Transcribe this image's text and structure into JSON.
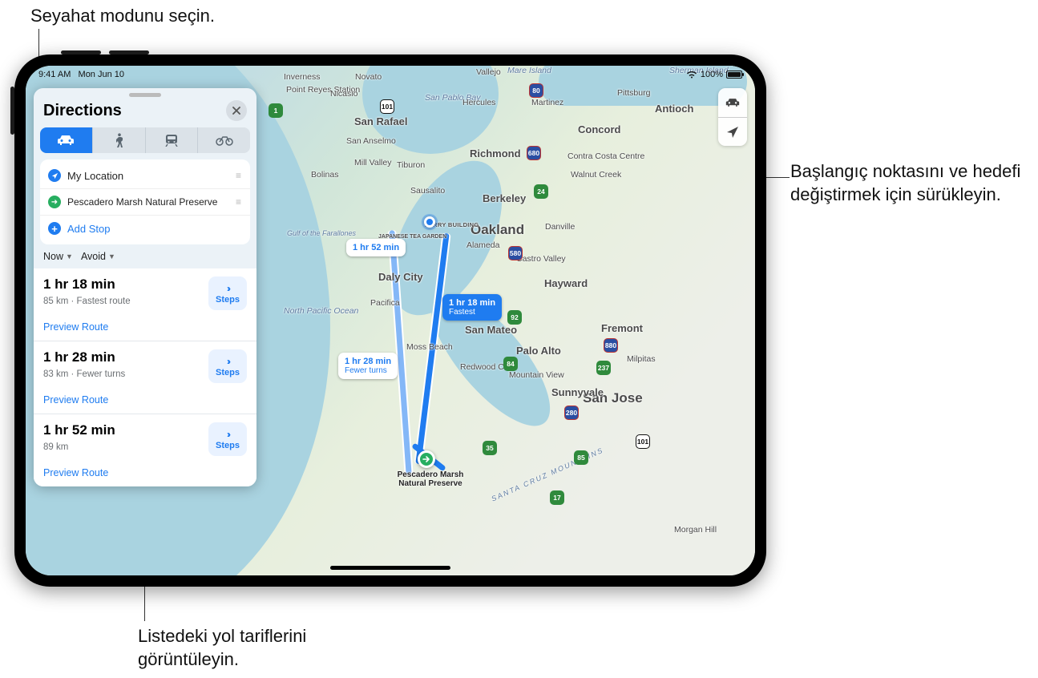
{
  "callouts": {
    "mode": "Seyahat modunu seçin.",
    "drag": "Başlangıç noktasını ve hedefi değiştirmek için sürükleyin.",
    "preview": "Listedeki yol tariflerini görüntüleyin."
  },
  "status": {
    "time": "9:41 AM",
    "date": "Mon Jun 10",
    "battery": "100%"
  },
  "panel": {
    "title": "Directions",
    "modes": [
      "drive",
      "walk",
      "transit",
      "cycle"
    ],
    "stops": {
      "origin": "My Location",
      "destination": "Pescadero Marsh Natural Preserve",
      "add": "Add Stop"
    },
    "options": {
      "now": "Now",
      "avoid": "Avoid"
    },
    "steps_label": "Steps",
    "preview_label": "Preview Route",
    "routes": [
      {
        "duration": "1 hr 18 min",
        "sub": "85 km · Fastest route"
      },
      {
        "duration": "1 hr 28 min",
        "sub": "83 km · Fewer turns"
      },
      {
        "duration": "1 hr 52 min",
        "sub": "89 km"
      }
    ]
  },
  "badges": {
    "main": {
      "line1": "1 hr 18 min",
      "line2": "Fastest"
    },
    "alt1": {
      "line1": "1 hr 28 min",
      "line2": "Fewer turns"
    },
    "alt2": {
      "line1": "1 hr 52 min"
    }
  },
  "map": {
    "destination_label": "Pescadero Marsh Natural Preserve",
    "region_labels": {
      "npacific": "North Pacific Ocean",
      "spablo": "San Pablo Bay",
      "mare": "Mare Island",
      "sherman": "Sherman Island",
      "gulf": "Gulf of the Farallones",
      "mtns": "SANTA CRUZ MOUNTAINS"
    },
    "cities": {
      "oakland": "Oakland",
      "sanjose": "San Jose",
      "sanrafael": "San Rafael",
      "richmond": "Richmond",
      "vallejo": "Vallejo",
      "concord": "Concord",
      "antioch": "Antioch",
      "pittsburg": "Pittsburg",
      "martinez": "Martinez",
      "hercules": "Hercules",
      "berkeley": "Berkeley",
      "danville": "Danville",
      "walnutcreek": "Walnut Creek",
      "castrovalley": "Castro Valley",
      "hayward": "Hayward",
      "fremont": "Fremont",
      "milpitas": "Milpitas",
      "sunnyvale": "Sunnyvale",
      "paloalto": "Palo Alto",
      "mountainview": "Mountain View",
      "redwood": "Redwood City",
      "sanmateo": "San Mateo",
      "dalycity": "Daly City",
      "pacifica": "Pacifica",
      "mossbeach": "Moss Beach",
      "sausalito": "Sausalito",
      "tiburon": "Tiburon",
      "novato": "Novato",
      "millvalley": "Mill Valley",
      "bolinas": "Bolinas",
      "inverness": "Inverness",
      "pointreyes": "Point Reyes Station",
      "nicasio": "Nicasio",
      "sananselmo": "San Anselmo",
      "morganhill": "Morgan Hill",
      "contracosta": "Contra Costa Centre",
      "alameda": "Alameda",
      "ferry": "FERRY BUILDING",
      "garden": "JAPANESE TEA GARDEN"
    },
    "shields": {
      "i80": "80",
      "i680": "680",
      "i880": "880",
      "i580": "580",
      "i280": "280",
      "us101": "101",
      "ca1": "1",
      "ca84": "84",
      "ca85": "85",
      "ca92": "92",
      "ca237": "237",
      "ca35": "35",
      "ca17": "17",
      "ca24": "24"
    }
  }
}
